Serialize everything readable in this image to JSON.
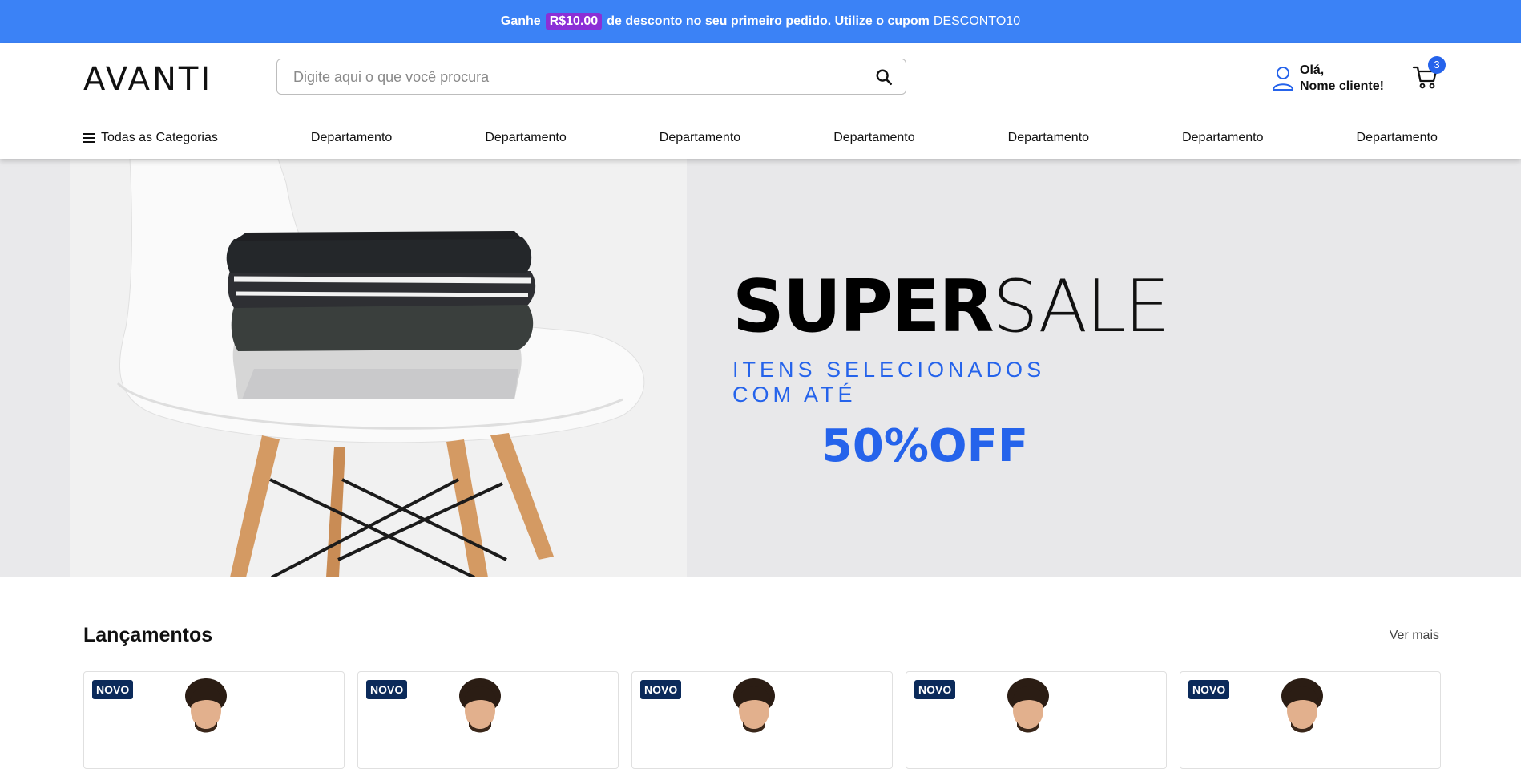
{
  "promo": {
    "prefix": "Ganhe",
    "amount": "R$10.00",
    "middle": "de desconto no seu primeiro pedido. Utilize o cupom",
    "coupon": "DESCONTO10"
  },
  "header": {
    "logo": "AVANTI",
    "search_placeholder": "Digite aqui o que você procura",
    "greeting_line1": "Olá,",
    "greeting_line2": "Nome cliente!",
    "cart_count": "3"
  },
  "nav": {
    "all_categories": "Todas as Categorias",
    "departments": [
      "Departamento",
      "Departamento",
      "Departamento",
      "Departamento",
      "Departamento",
      "Departamento",
      "Departamento"
    ]
  },
  "hero": {
    "title_bold": "SUPER",
    "title_light": "SALE",
    "subtitle": "ITENS SELECIONADOS COM ATÉ",
    "discount": "50%OFF"
  },
  "launches": {
    "title": "Lançamentos",
    "see_more": "Ver mais",
    "cards": [
      {
        "tag": "NOVO"
      },
      {
        "tag": "NOVO"
      },
      {
        "tag": "NOVO"
      },
      {
        "tag": "NOVO"
      },
      {
        "tag": "NOVO"
      }
    ]
  },
  "colors": {
    "promo_bg": "#3b82f6",
    "accent": "#2563eb",
    "coupon_badge": "#8b2fd6",
    "tag_bg": "#0b2a5a"
  }
}
